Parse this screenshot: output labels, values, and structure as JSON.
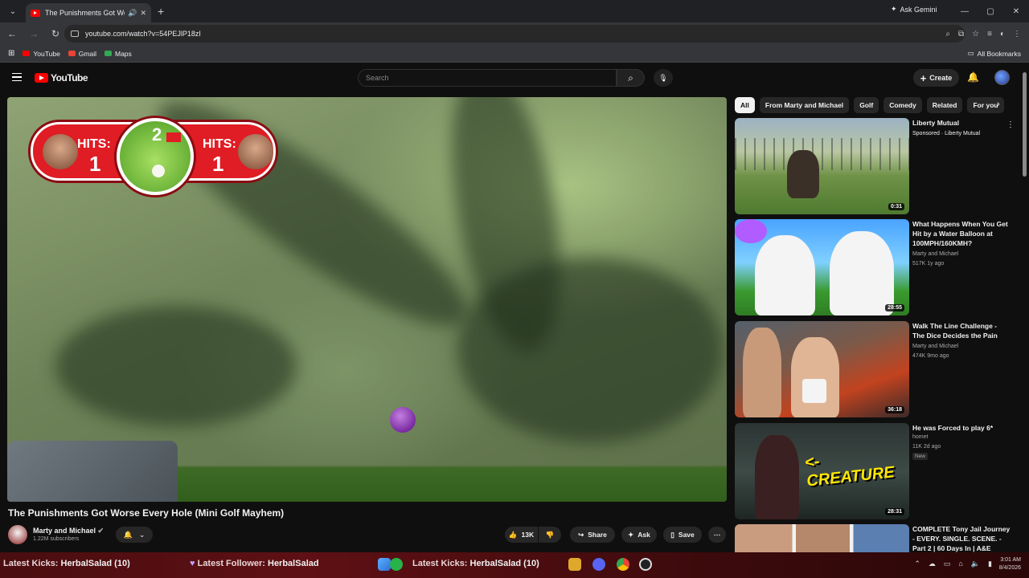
{
  "browser": {
    "tab_title": "The Punishments Got Worse",
    "url": "youtube.com/watch?v=54PEJlP18zI",
    "ask_gemini": "Ask Gemini",
    "bookmarks": [
      {
        "label": "YouTube",
        "color": "#ff0000"
      },
      {
        "label": "Gmail",
        "color": "#ea4335"
      },
      {
        "label": "Maps",
        "color": "#34a853"
      }
    ],
    "all_bookmarks": "All Bookmarks"
  },
  "header": {
    "logo": "YouTube",
    "search_placeholder": "Search",
    "create_label": "Create"
  },
  "video": {
    "scoreboard": {
      "left_label": "HITS:",
      "left_value": "1",
      "hole_number": "2",
      "right_label": "HITS:",
      "right_value": "1"
    },
    "title": "The Punishments Got Worse Every Hole (Mini Golf Mayhem)",
    "channel": "Marty and Michael",
    "subscribers": "1.22M subscribers",
    "likes": "13K",
    "share": "Share",
    "ask": "Ask",
    "save": "Save"
  },
  "chips": [
    "All",
    "From Marty and Michael",
    "Golf",
    "Comedy",
    "Related",
    "For you"
  ],
  "recommendations": [
    {
      "title": "Liberty Mutual",
      "meta1": "Sponsored · Liberty Mutual",
      "meta2": "",
      "duration": "0:31",
      "sponsored": true
    },
    {
      "title": "What Happens When You Get Hit by a Water Balloon at 100MPH/160KMH?",
      "meta1": "Marty and Michael",
      "meta2": "517K  1y ago",
      "duration": "28:55"
    },
    {
      "title": "Walk The Line Challenge - The Dice Decides the Pain",
      "meta1": "Marty and Michael",
      "meta2": "474K  9mo ago",
      "duration": "36:18"
    },
    {
      "title": "He was Forced to play 6*",
      "meta1": "homet",
      "meta2": "11K  2d ago",
      "duration": "28:31",
      "badge": "New",
      "thumb_text": "<- CREATURE"
    },
    {
      "title": "COMPLETE Tony Jail Journey - EVERY. SINGLE. SCENE. - Part 2 | 60 Days In | A&E",
      "meta1": "",
      "meta2": "",
      "duration": ""
    }
  ],
  "overlay": {
    "kicks_label": "Latest Kicks:",
    "kicks_value": "HerbalSalad (10)",
    "follower_label": "Latest Follower:",
    "follower_value": "HerbalSalad",
    "kicks2_label": "Latest Kicks:",
    "kicks2_value": "HerbalSalad (10)"
  },
  "clock": {
    "time": "3:01 AM",
    "date": "8/4/2026"
  }
}
